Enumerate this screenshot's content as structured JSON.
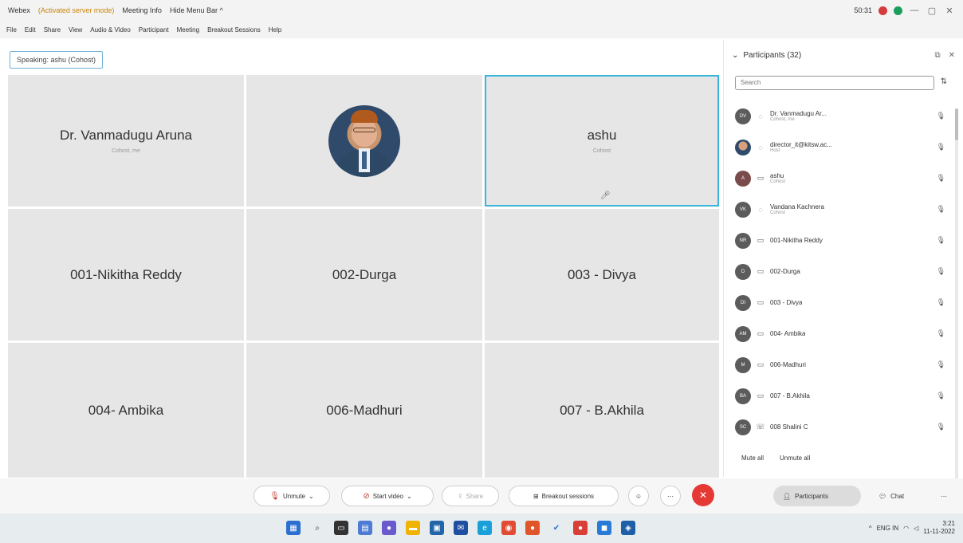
{
  "titlebar": {
    "app": "Webex",
    "warning": "(Activated server mode)",
    "meeting_info": "Meeting Info",
    "host": "Hide Menu Bar ^",
    "timer": "50:31",
    "rec_colors": [
      "#d63b3b",
      "#1a9e5c"
    ],
    "controls": [
      "—",
      "▢",
      "✕"
    ]
  },
  "menubar": [
    "File",
    "Edit",
    "Share",
    "View",
    "Audio & Video",
    "Participant",
    "Meeting",
    "Breakout Sessions",
    "Help"
  ],
  "speaking": "Speaking: ashu (Cohost)",
  "gallery": {
    "tiles": [
      {
        "name": "Dr. Vanmadugu Aruna",
        "sub": "Cohost, me"
      },
      {
        "name": "",
        "sub": "",
        "photo": true
      },
      {
        "name": "ashu",
        "sub": "Cohost",
        "active": true
      },
      {
        "name": "001-Nikitha Reddy",
        "sub": ""
      },
      {
        "name": "002-Durga",
        "sub": ""
      },
      {
        "name": "003 - Divya",
        "sub": ""
      },
      {
        "name": "004- Ambika",
        "sub": ""
      },
      {
        "name": "006-Madhuri",
        "sub": ""
      },
      {
        "name": "007 - B.Akhila",
        "sub": ""
      }
    ]
  },
  "panel": {
    "title": "Participants (32)",
    "search_placeholder": "Search",
    "participants": [
      {
        "initials": "DV",
        "name": "Dr. Vanmadugu Ar...",
        "role": "Cohost, me"
      },
      {
        "initials": "",
        "name": "director_it@kitsw.ac...",
        "role": "Host"
      },
      {
        "initials": "A",
        "name": "ashu",
        "role": "Cohost"
      },
      {
        "initials": "VK",
        "name": "Vandana Kachnera",
        "role": "Cohost"
      },
      {
        "initials": "NR",
        "name": "001-Nikitha Reddy",
        "role": ""
      },
      {
        "initials": "D",
        "name": "002-Durga",
        "role": ""
      },
      {
        "initials": "DI",
        "name": "003 - Divya",
        "role": ""
      },
      {
        "initials": "AM",
        "name": "004- Ambika",
        "role": ""
      },
      {
        "initials": "M",
        "name": "006-Madhuri",
        "role": ""
      },
      {
        "initials": "BA",
        "name": "007 - B.Akhila",
        "role": ""
      },
      {
        "initials": "SC",
        "name": "008 Shalini C",
        "role": ""
      }
    ],
    "mute_all": "Mute all",
    "unmute_all": "Unmute all"
  },
  "toolbar": {
    "unmute": "Unmute",
    "start_video": "Start video",
    "share": "Share",
    "breakout": "Breakout sessions",
    "participants": "Participants",
    "chat": "Chat"
  },
  "taskbar": {
    "time": "3:21",
    "date": "11-11-2022",
    "lang": "ENG IN"
  }
}
